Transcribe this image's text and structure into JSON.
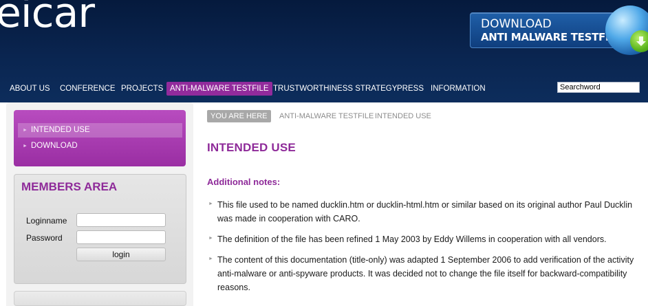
{
  "header": {
    "logo": "eicar",
    "banner": {
      "line1": "DOWNLOAD",
      "line2": "ANTI MALWARE TESTFILE"
    }
  },
  "nav": {
    "items": [
      {
        "label": "ABOUT US"
      },
      {
        "label": "CONFERENCE"
      },
      {
        "label": "PROJECTS"
      },
      {
        "label": "ANTI-MALWARE TESTFILE"
      },
      {
        "label": "TRUSTWORTHINESS STRATEGY"
      },
      {
        "label": "PRESS"
      },
      {
        "label": "INFORMATION"
      }
    ],
    "active_index": 3,
    "search_value": "Searchword"
  },
  "sidebar": {
    "subnav": [
      {
        "label": "INTENDED USE"
      },
      {
        "label": "DOWNLOAD"
      }
    ],
    "members": {
      "title": "MEMBERS AREA",
      "login_label": "Loginname",
      "password_label": "Password",
      "button_label": "login"
    }
  },
  "breadcrumb": {
    "prefix": "YOU ARE HERE",
    "items": [
      "ANTI-MALWARE TESTFILE",
      "INTENDED USE"
    ]
  },
  "main": {
    "title": "INTENDED USE",
    "subhead": "Additional notes:",
    "notes": [
      [
        "This file used to be named ducklin.htm or ducklin-html.htm or similar based on its original author Paul Ducklin",
        "was made in cooperation with CARO."
      ],
      [
        "The definition of the file has been refined 1 May 2003 by Eddy Willems in cooperation with all vendors."
      ],
      [
        "The content of this documentation (title-only) was adapted 1 September 2006 to add verification of the activity",
        "anti-malware or anti-spyware products. It was decided not to change the file itself for backward-compatibility",
        "reasons."
      ]
    ]
  },
  "colors": {
    "header_bg": "#0a2550",
    "accent_purple": "#8e2a99",
    "nav_active": "#922b9c"
  }
}
